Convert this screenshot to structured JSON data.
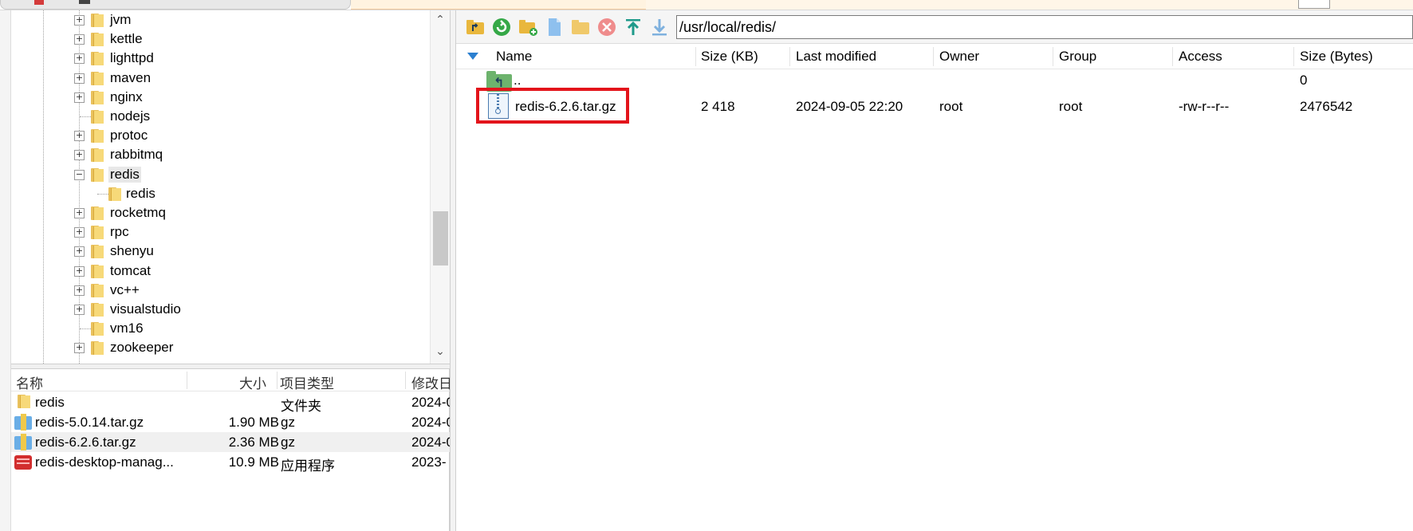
{
  "tree": {
    "items": [
      {
        "label": "jvm",
        "expander": "+"
      },
      {
        "label": "kettle",
        "expander": "+"
      },
      {
        "label": "lighttpd",
        "expander": "+"
      },
      {
        "label": "maven",
        "expander": "+"
      },
      {
        "label": "nginx",
        "expander": "+"
      },
      {
        "label": "nodejs",
        "expander": ""
      },
      {
        "label": "protoc",
        "expander": "+"
      },
      {
        "label": "rabbitmq",
        "expander": "+"
      },
      {
        "label": "redis",
        "expander": "−"
      },
      {
        "label": "redis",
        "expander": ""
      },
      {
        "label": "rocketmq",
        "expander": "+"
      },
      {
        "label": "rpc",
        "expander": "+"
      },
      {
        "label": "shenyu",
        "expander": "+"
      },
      {
        "label": "tomcat",
        "expander": "+"
      },
      {
        "label": "vc++",
        "expander": "+"
      },
      {
        "label": "visualstudio",
        "expander": "+"
      },
      {
        "label": "vm16",
        "expander": ""
      },
      {
        "label": "zookeeper",
        "expander": "+"
      }
    ],
    "scroll_up": "⌃",
    "scroll_down": "⌄"
  },
  "local": {
    "headers": {
      "name": "名称",
      "size": "大小",
      "type": "项目类型",
      "modified": "修改日"
    },
    "rows": [
      {
        "name": "redis",
        "size": "",
        "type": "文件夹",
        "modified": "2024-0"
      },
      {
        "name": "redis-5.0.14.tar.gz",
        "size": "1.90 MB",
        "type": "gz",
        "modified": "2024-0"
      },
      {
        "name": "redis-6.2.6.tar.gz",
        "size": "2.36 MB",
        "type": "gz",
        "modified": "2024-0"
      },
      {
        "name": "redis-desktop-manag...",
        "size": "10.9 MB",
        "type": "应用程序",
        "modified": "2023-"
      }
    ]
  },
  "remote": {
    "path": "/usr/local/redis/",
    "headers": {
      "name": "Name",
      "size_kb": "Size (KB)",
      "modified": "Last modified",
      "owner": "Owner",
      "group": "Group",
      "access": "Access",
      "size_bytes": "Size (Bytes)"
    },
    "parent_row": {
      "name": "..",
      "size_bytes": "0"
    },
    "rows": [
      {
        "name": "redis-6.2.6.tar.gz",
        "size_kb": "2 418",
        "modified": "2024-09-05 22:20",
        "owner": "root",
        "group": "root",
        "access": "-rw-r--r--",
        "size_bytes": "2476542"
      }
    ]
  },
  "colors": {
    "highlight": "#e3141b",
    "folder": "#f7d979",
    "accent": "#2a7fd0"
  }
}
